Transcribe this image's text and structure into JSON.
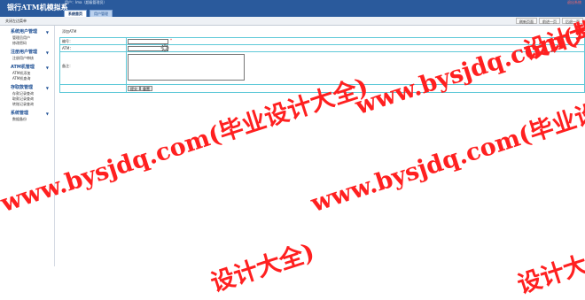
{
  "header": {
    "app_title": "银行ATM机模拟系",
    "user_info": "用户：lma（超级管理员）",
    "logout": "退出系统",
    "tabs": [
      {
        "label": "系统首页",
        "active": true
      },
      {
        "label": "用户管理",
        "active": false
      }
    ]
  },
  "toolbar": {
    "collapse_label": "关闭左边菜单",
    "buttons": [
      "刷新页面",
      "前进一页",
      "后退一页"
    ]
  },
  "sidebar": {
    "groups": [
      {
        "title": "系统用户管理",
        "items": [
          "管理员用户",
          "修改密码"
        ]
      },
      {
        "title": "注册用户管理",
        "items": [
          "注册用户审核"
        ]
      },
      {
        "title": "ATM机管理",
        "items": [
          "ATM机添加",
          "ATM机查询"
        ]
      },
      {
        "title": "存取款管理",
        "items": [
          "存款记录查询",
          "取款记录查询",
          "转账记录查询"
        ]
      },
      {
        "title": "系统管理",
        "items": [
          "数据备份"
        ]
      }
    ]
  },
  "form": {
    "title": "添加ATM",
    "fields": [
      {
        "label": "编号：",
        "value": "",
        "required_mark": "*"
      },
      {
        "label": "ATM：",
        "value": ""
      },
      {
        "label": "备注：",
        "value": ""
      }
    ],
    "submit_label": "提交",
    "reset_label": "重置"
  },
  "watermark": {
    "text": "www.bysjdq.com(毕业设计大全)",
    "text_partial": "设计大全)"
  },
  "colors": {
    "header_bg": "#2a5a9c",
    "table_border": "#5fc9d8",
    "watermark": "#ff2020"
  }
}
